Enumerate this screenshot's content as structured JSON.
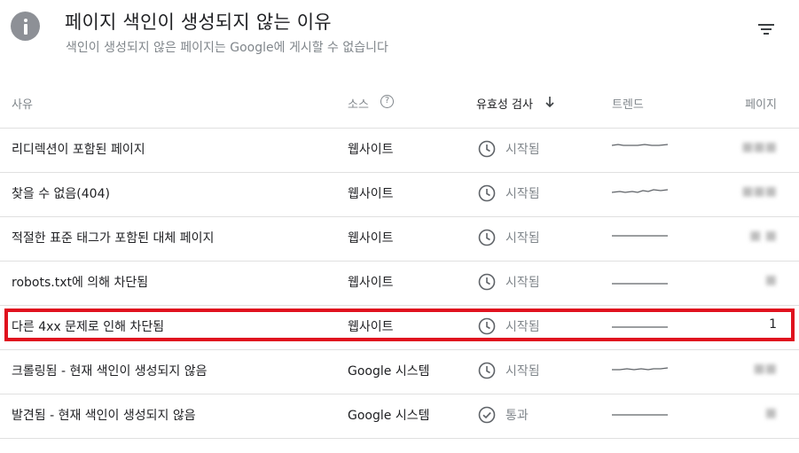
{
  "header": {
    "title": "페이지 색인이 생성되지 않는 이유",
    "subtitle": "색인이 생성되지 않은 페이지는 Google에 게시할 수 없습니다",
    "info_icon": "info-icon",
    "filter_icon": "filter-icon"
  },
  "columns": {
    "reason": "사유",
    "source": "소스",
    "validation": "유효성 검사",
    "trend": "트렌드",
    "pages": "페이지"
  },
  "rows": [
    {
      "reason": "리디렉션이 포함된 페이지",
      "source": "웹사이트",
      "validation": "시작됨",
      "validation_icon": "clock-icon",
      "pages": "■■■",
      "pages_hidden": true
    },
    {
      "reason": "찾을 수 없음(404)",
      "source": "웹사이트",
      "validation": "시작됨",
      "validation_icon": "clock-icon",
      "pages": "■■■",
      "pages_hidden": true
    },
    {
      "reason": "적절한 표준 태그가 포함된 대체 페이지",
      "source": "웹사이트",
      "validation": "시작됨",
      "validation_icon": "clock-icon",
      "pages": "■ ■",
      "pages_hidden": true
    },
    {
      "reason": "robots.txt에 의해 차단됨",
      "source": "웹사이트",
      "validation": "시작됨",
      "validation_icon": "clock-icon",
      "pages": "■",
      "pages_hidden": true
    },
    {
      "reason": "다른 4xx 문제로 인해 차단됨",
      "source": "웹사이트",
      "validation": "시작됨",
      "validation_icon": "clock-icon",
      "pages": "1",
      "pages_hidden": false
    },
    {
      "reason": "크롤링됨 - 현재 색인이 생성되지 않음",
      "source": "Google 시스템",
      "validation": "시작됨",
      "validation_icon": "clock-icon",
      "pages": "■■",
      "pages_hidden": true
    },
    {
      "reason": "발견됨 - 현재 색인이 생성되지 않음",
      "source": "Google 시스템",
      "validation": "통과",
      "validation_icon": "check-circle-icon",
      "pages": "■",
      "pages_hidden": true
    }
  ],
  "colors": {
    "highlight": "#e0101e",
    "trend_line": "#5f6368",
    "muted_text": "#80868b"
  }
}
